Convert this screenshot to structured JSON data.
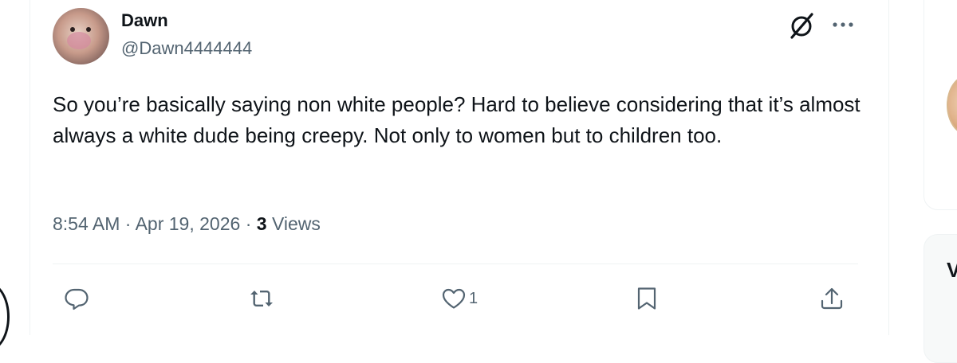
{
  "tweet": {
    "display_name": "Dawn",
    "handle": "@Dawn4444444",
    "text": "So you’re basically saying non white people? Hard to believe considering that it’s almost always a white dude being creepy. Not only to women but to children too.",
    "time": "8:54 AM",
    "separator": "·",
    "date": "Apr 19, 2026",
    "views_count": "3",
    "views_label": "Views"
  },
  "actions": {
    "like_count": "1"
  },
  "icons": {
    "grok": "grok-icon",
    "more": "more-dots-icon",
    "reply": "reply-icon",
    "retweet": "retweet-icon",
    "like": "heart-icon",
    "bookmark": "bookmark-icon",
    "share": "share-icon"
  },
  "sidebar": {
    "partial_letter": "V"
  },
  "colors": {
    "text": "#0f1419",
    "secondary": "#536471",
    "border": "#eff3f4"
  }
}
